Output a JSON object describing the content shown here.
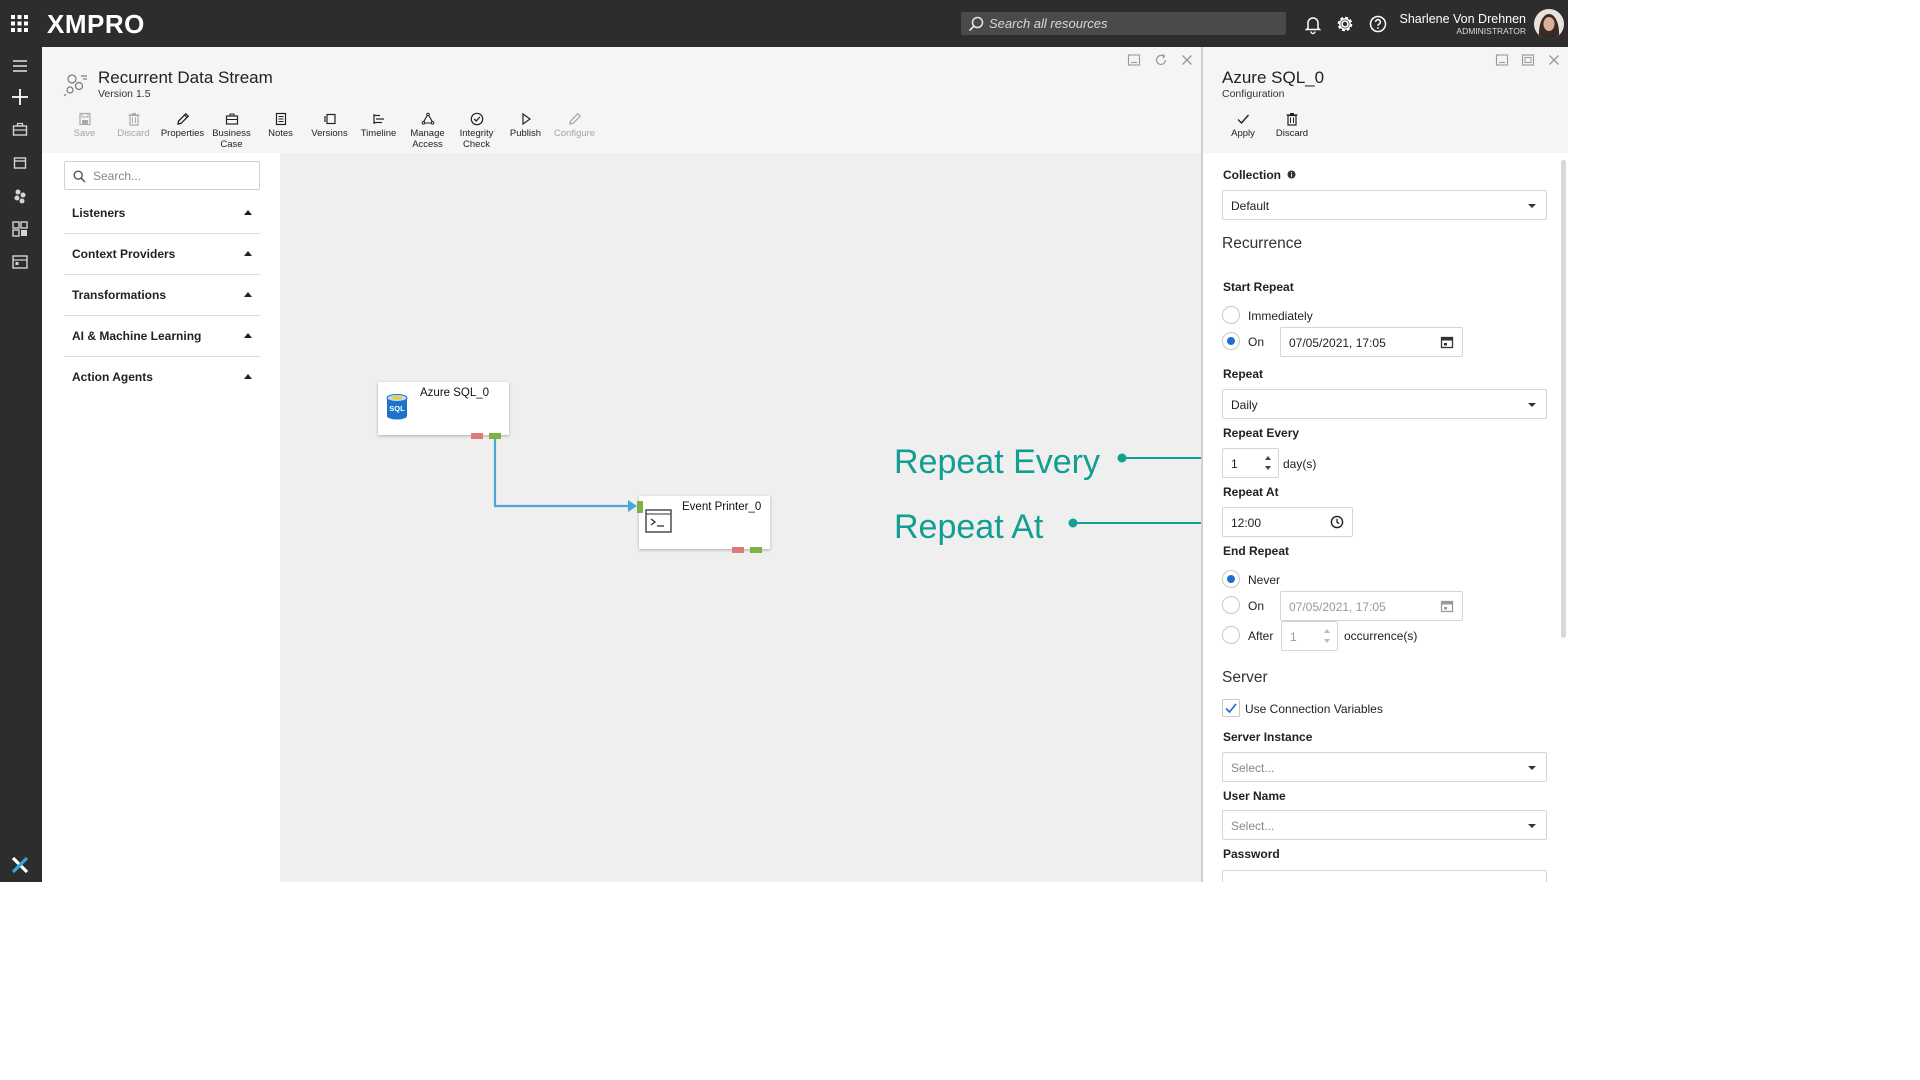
{
  "app": {
    "logo": "XMPRO",
    "search_placeholder": "Search all resources",
    "user": {
      "name": "Sharlene Von Drehnen",
      "role": "ADMINISTRATOR"
    }
  },
  "stream": {
    "title": "Recurrent Data Stream",
    "version": "Version 1.5",
    "toolbar": [
      {
        "label": "Save",
        "icon": "save-icon",
        "enabled": false
      },
      {
        "label": "Discard",
        "icon": "trash-icon",
        "enabled": false
      },
      {
        "label": "Properties",
        "icon": "pencil-icon",
        "enabled": true
      },
      {
        "label": "Business Case",
        "icon": "briefcase-icon",
        "enabled": true
      },
      {
        "label": "Notes",
        "icon": "notes-icon",
        "enabled": true
      },
      {
        "label": "Versions",
        "icon": "versions-icon",
        "enabled": true
      },
      {
        "label": "Timeline",
        "icon": "timeline-icon",
        "enabled": true
      },
      {
        "label": "Manage Access",
        "icon": "manage-access-icon",
        "enabled": true
      },
      {
        "label": "Integrity Check",
        "icon": "check-circle-icon",
        "enabled": true
      },
      {
        "label": "Publish",
        "icon": "play-icon",
        "enabled": true
      },
      {
        "label": "Configure",
        "icon": "pencil-icon",
        "enabled": false
      }
    ]
  },
  "palette": {
    "search_placeholder": "Search...",
    "categories": [
      "Listeners",
      "Context Providers",
      "Transformations",
      "AI & Machine Learning",
      "Action Agents"
    ]
  },
  "canvas": {
    "nodes": [
      {
        "label": "Azure SQL_0",
        "icon": "sql-database-icon",
        "icon_text": "SQL"
      },
      {
        "label": "Event Printer_0",
        "icon": "terminal-icon"
      }
    ]
  },
  "annotations": {
    "repeat_every": "Repeat Every",
    "repeat_at": "Repeat At",
    "color": "#129e90"
  },
  "config": {
    "title": "Azure SQL_0",
    "subtitle": "Configuration",
    "apply_label": "Apply",
    "discard_label": "Discard",
    "collection_label": "Collection",
    "collection_value": "Default",
    "recurrence_heading": "Recurrence",
    "start_repeat_label": "Start Repeat",
    "immediately_label": "Immediately",
    "on_label": "On",
    "start_date": "07/05/2021, 17:05",
    "repeat_label": "Repeat",
    "repeat_value": "Daily",
    "repeat_every_label": "Repeat Every",
    "repeat_every_value": "1",
    "repeat_every_unit": "day(s)",
    "repeat_at_label": "Repeat At",
    "repeat_at_value": "12:00",
    "end_repeat_label": "End Repeat",
    "never_label": "Never",
    "end_on_label": "On",
    "end_date": "07/05/2021, 17:05",
    "after_label": "After",
    "after_value": "1",
    "occurrences_unit": "occurrence(s)",
    "start_repeat_selected": "On",
    "end_repeat_selected": "Never",
    "server_heading": "Server",
    "use_connection_variables_label": "Use Connection Variables",
    "use_connection_variables_checked": true,
    "server_instance_label": "Server Instance",
    "server_instance_placeholder": "Select...",
    "user_name_label": "User Name",
    "user_name_placeholder": "Select...",
    "password_label": "Password"
  },
  "colors": {
    "topbar": "#2d2d2d",
    "accent_blue": "#1f6fd1",
    "connector": "#4aa8d8",
    "port_error": "#e07a7a",
    "port_ok": "#7cb342"
  }
}
